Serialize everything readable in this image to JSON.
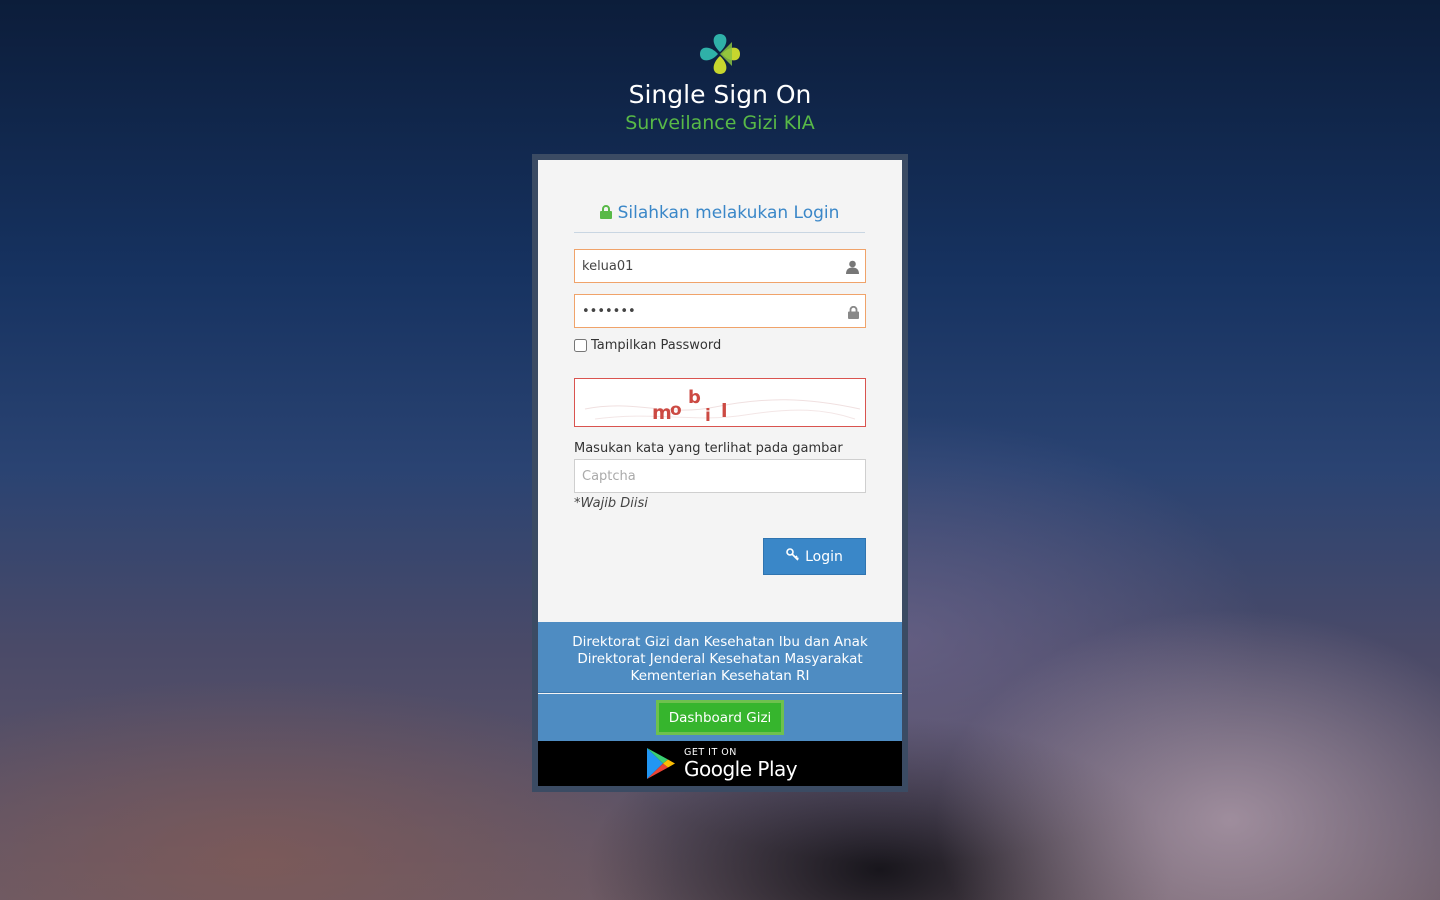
{
  "header": {
    "title": "Single Sign On",
    "subtitle": "Surveilance Gizi KIA",
    "logo_icon": "kemenkes-logo-icon"
  },
  "login": {
    "heading": "Silahkan melakukan Login",
    "username": {
      "value": "kelua01",
      "icon": "user-icon"
    },
    "password": {
      "value": "•••••••",
      "icon": "lock-icon"
    },
    "show_password_label": "Tampilkan Password",
    "captcha_text": "mobil",
    "captcha_instruction": "Masukan kata yang terlihat pada gambar",
    "captcha_placeholder": "Captcha",
    "captcha_value": "",
    "required_note": "*Wajib Diisi",
    "login_button": "Login"
  },
  "footer": {
    "line1": "Direktorat Gizi dan Kesehatan Ibu dan Anak",
    "line2": "Direktorat Jenderal Kesehatan Masyarakat",
    "line3": "Kementerian Kesehatan RI",
    "dashboard_button": "Dashboard Gizi",
    "play_small": "GET IT ON",
    "play_big": "Google Play"
  },
  "colors": {
    "accent_blue": "#3a87c8",
    "accent_green": "#58b947",
    "dashboard_green": "#36b52d",
    "input_border": "#f0a36a",
    "captcha_border": "#d9534f"
  }
}
